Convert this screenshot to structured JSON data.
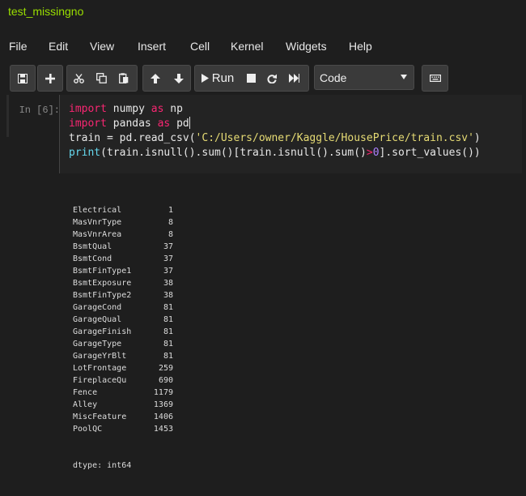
{
  "notebook": {
    "title": "test_missingno"
  },
  "menu": [
    "File",
    "Edit",
    "View",
    "Insert",
    "Cell",
    "Kernel",
    "Widgets",
    "Help"
  ],
  "toolbar": {
    "run_label": "Run",
    "cell_type": "Code",
    "icons": [
      "save-icon",
      "insert-cell-icon",
      "cut-icon",
      "copy-icon",
      "paste-icon",
      "move-up-icon",
      "move-down-icon",
      "run-icon",
      "stop-icon",
      "restart-icon",
      "fast-forward-icon",
      "keyboard-icon"
    ]
  },
  "cell": {
    "prompt": "In [6]:",
    "output": [
      {
        "name": "Electrical",
        "value": "1"
      },
      {
        "name": "MasVnrType",
        "value": "8"
      },
      {
        "name": "MasVnrArea",
        "value": "8"
      },
      {
        "name": "BsmtQual",
        "value": "37"
      },
      {
        "name": "BsmtCond",
        "value": "37"
      },
      {
        "name": "BsmtFinType1",
        "value": "37"
      },
      {
        "name": "BsmtExposure",
        "value": "38"
      },
      {
        "name": "BsmtFinType2",
        "value": "38"
      },
      {
        "name": "GarageCond",
        "value": "81"
      },
      {
        "name": "GarageQual",
        "value": "81"
      },
      {
        "name": "GarageFinish",
        "value": "81"
      },
      {
        "name": "GarageType",
        "value": "81"
      },
      {
        "name": "GarageYrBlt",
        "value": "81"
      },
      {
        "name": "LotFrontage",
        "value": "259"
      },
      {
        "name": "FireplaceQu",
        "value": "690"
      },
      {
        "name": "Fence",
        "value": "1179"
      },
      {
        "name": "Alley",
        "value": "1369"
      },
      {
        "name": "MiscFeature",
        "value": "1406"
      },
      {
        "name": "PoolQC",
        "value": "1453"
      }
    ],
    "dtype": "dtype: int64"
  },
  "code": {
    "l1": [
      "import",
      " numpy ",
      "as",
      " np"
    ],
    "l2": [
      "import",
      " pandas ",
      "as",
      " pd"
    ],
    "l3": [
      "train = pd.read_csv(",
      "'C:/Users/owner/Kaggle/HousePrice/train.csv'",
      ")"
    ],
    "l4": [
      "print",
      "(train.isnull().sum()[train.isnull().sum()",
      ">",
      "0",
      "].sort_values())"
    ]
  }
}
